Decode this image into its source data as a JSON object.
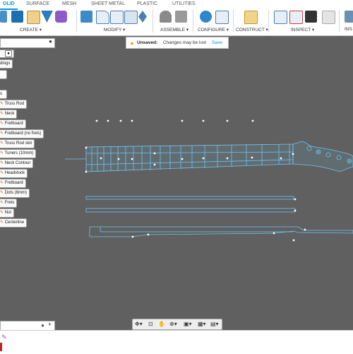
{
  "ribbon": {
    "tabs": [
      "OLID",
      "SURFACE",
      "MESH",
      "SHEET METAL",
      "PLASTIC",
      "UTILITIES"
    ],
    "groups": [
      "CREATE ▾",
      "MODIFY ▾",
      "ASSEMBLE ▾",
      "CONFIGURE ▾",
      "CONSTRUCT ▾",
      "INSPECT ▾",
      "INS"
    ]
  },
  "notice": {
    "label": "Unsaved:",
    "message": "Changes may be lost",
    "action": "Save"
  },
  "browser": {
    "items": [
      "dings",
      "s",
      "Truss Rod",
      "Neck",
      "Fretboard",
      "Fretboard (no frets)",
      "Truss Rod slot",
      "Tuners (10mm)",
      "Neck Contour",
      "Headstock",
      "Fretboard",
      "Dots (6mm)",
      "Frets",
      "Nut",
      "Centerline"
    ]
  },
  "colors": {
    "sketch": "#6ec4f0",
    "background": "#606060",
    "accent": "#0696d7"
  },
  "icons": [
    "orbit-icon",
    "pan-icon",
    "hand-icon",
    "zoom-icon",
    "display-settings-icon",
    "grid-icon",
    "viewports-icon"
  ]
}
